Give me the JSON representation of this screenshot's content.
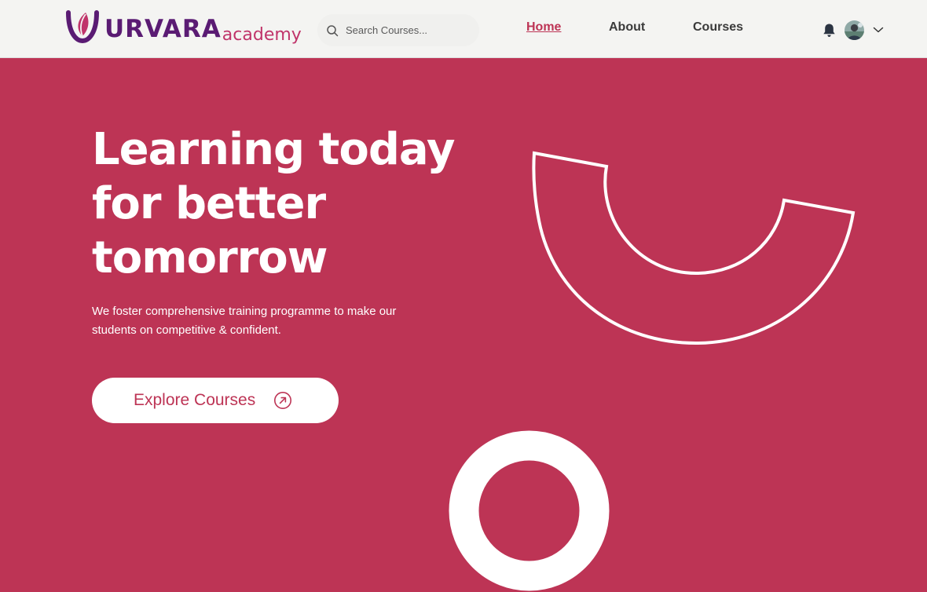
{
  "brand": {
    "name": "URVARA",
    "suffix": "academy",
    "primary_color": "#5a1b73",
    "accent_color": "#c0346a"
  },
  "search": {
    "placeholder": "Search Courses..."
  },
  "nav": {
    "items": [
      {
        "label": "Home",
        "active": true
      },
      {
        "label": "About",
        "active": false
      },
      {
        "label": "Courses",
        "active": false
      }
    ]
  },
  "header_actions": {
    "notification_icon": "bell-icon",
    "user_menu_icon": "chevron-down-icon"
  },
  "hero": {
    "title": "Learning today for better tomorrow",
    "subtitle": "We foster comprehensive training programme to make our students on competitive & confident.",
    "cta_label": "Explore Courses",
    "cta_icon": "arrow-up-right-circle-icon",
    "background_color": "#bd3455"
  }
}
